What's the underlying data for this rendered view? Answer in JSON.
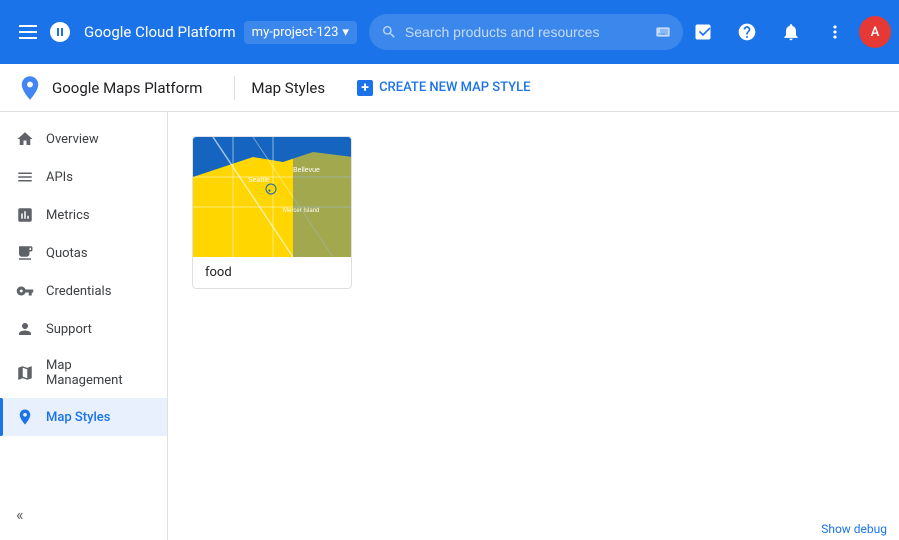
{
  "topNav": {
    "title": "Google Cloud Platform",
    "project": "my-project-123",
    "searchPlaceholder": "Search products and resources",
    "chevronDown": "▾"
  },
  "subNav": {
    "logo": "Google Maps Platform",
    "pageTitle": "Map Styles",
    "createButton": "CREATE NEW MAP STYLE"
  },
  "sidebar": {
    "items": [
      {
        "id": "overview",
        "label": "Overview",
        "icon": "⊙"
      },
      {
        "id": "apis",
        "label": "APIs",
        "icon": "≡"
      },
      {
        "id": "metrics",
        "label": "Metrics",
        "icon": "▦"
      },
      {
        "id": "quotas",
        "label": "Quotas",
        "icon": "▣"
      },
      {
        "id": "credentials",
        "label": "Credentials",
        "icon": "⚷"
      },
      {
        "id": "support",
        "label": "Support",
        "icon": "👤"
      },
      {
        "id": "map-management",
        "label": "Map Management",
        "icon": "▦"
      },
      {
        "id": "map-styles",
        "label": "Map Styles",
        "icon": "◎",
        "active": true
      }
    ]
  },
  "content": {
    "mapStyle": {
      "label": "food"
    }
  },
  "bottomBar": {
    "label": "Show debug"
  }
}
